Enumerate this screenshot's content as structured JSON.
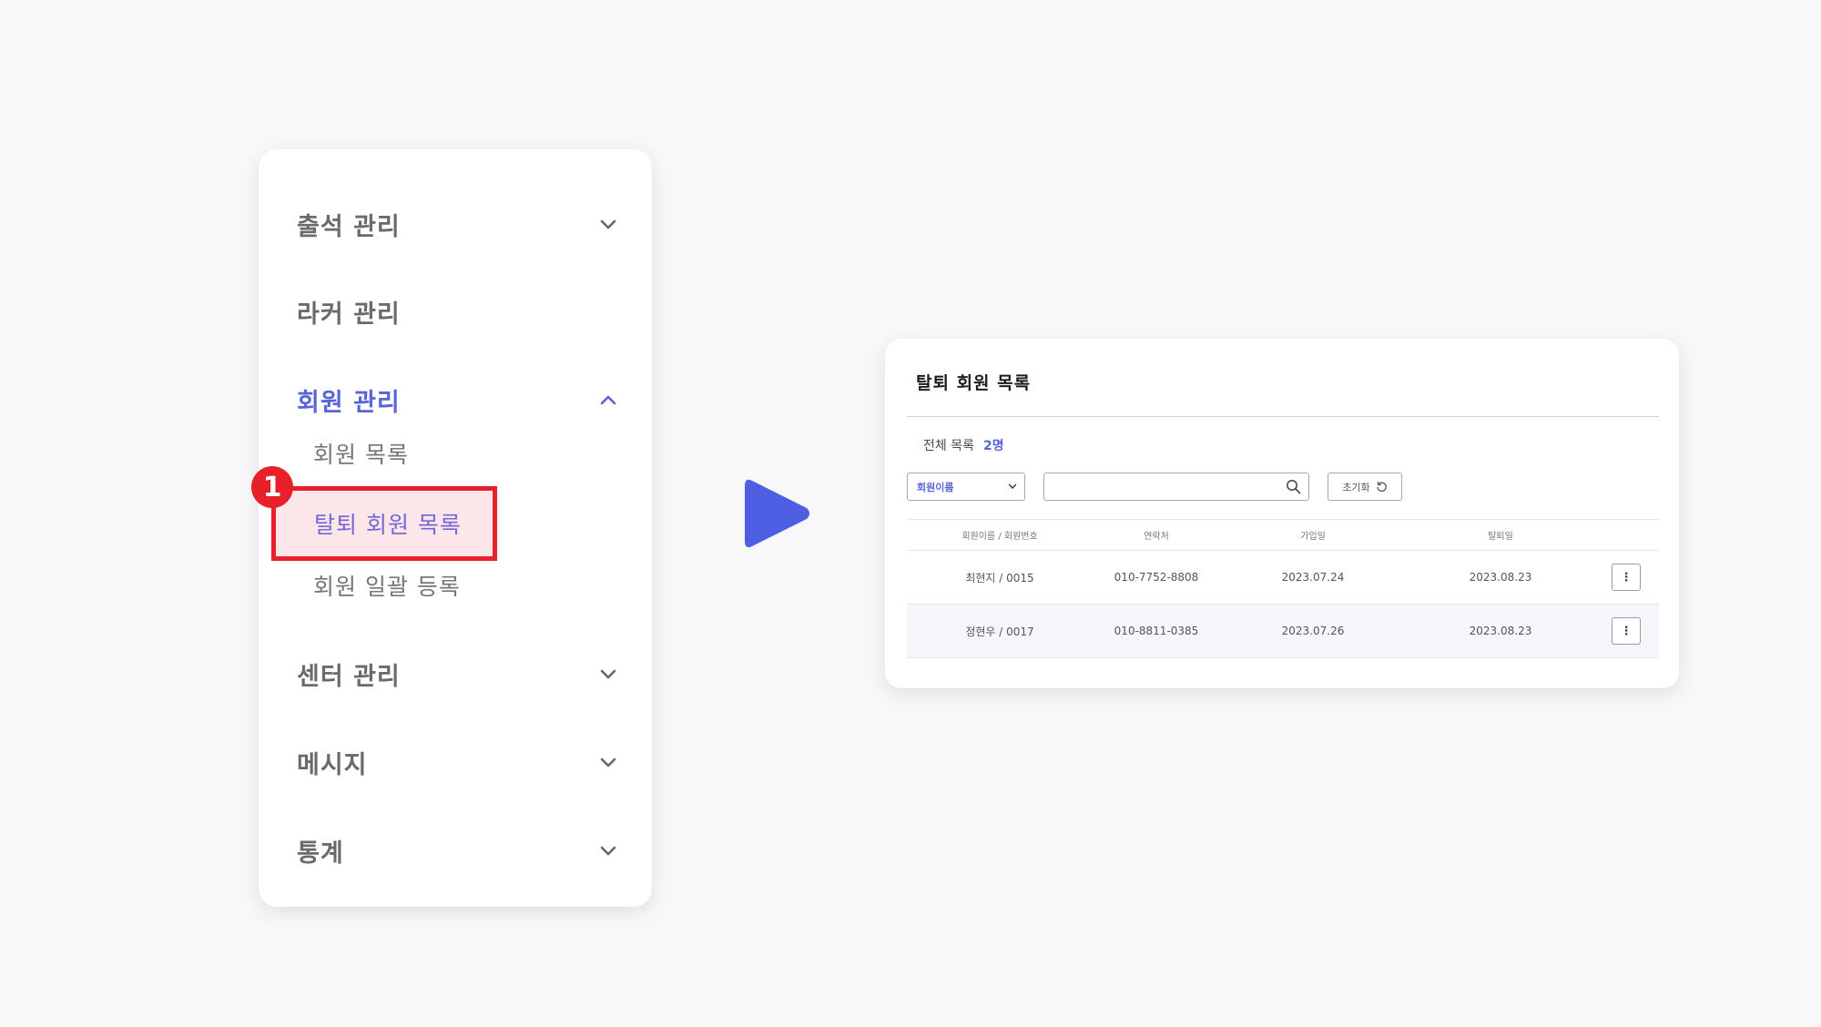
{
  "sidebar": {
    "items": [
      {
        "label": "출석 관리",
        "icon": "chevron-down-icon"
      },
      {
        "label": "라커 관리"
      },
      {
        "label": "회원 관리",
        "icon": "chevron-up-icon",
        "active": true,
        "children": [
          {
            "label": "회원 목록"
          },
          {
            "label": "탈퇴 회원 목록",
            "highlighted": true
          },
          {
            "label": "회원 일괄 등록"
          }
        ]
      },
      {
        "label": "센터 관리",
        "icon": "chevron-down-icon"
      },
      {
        "label": "메시지",
        "icon": "chevron-down-icon"
      },
      {
        "label": "통계",
        "icon": "chevron-down-icon"
      }
    ]
  },
  "step_badge": "1",
  "colors": {
    "accent": "#5865d8",
    "highlight_border": "#e8202a",
    "highlight_fill": "#fce6ea",
    "arrow": "#4f5fe3"
  },
  "panel": {
    "title": "탈퇴 회원 목록",
    "total_label": "전체 목록",
    "total_count": "2명",
    "filter_select": {
      "value": "회원이름",
      "icon": "chevron-down-icon"
    },
    "search": {
      "value": "",
      "icon": "search-icon"
    },
    "reset_button": {
      "label": "초기화",
      "icon": "refresh-icon"
    },
    "table": {
      "headers": [
        "회원이름 / 회원번호",
        "연락처",
        "가입일",
        "탈퇴일"
      ],
      "rows": [
        {
          "name": "최현지 / 0015",
          "phone": "010-7752-8808",
          "joined": "2023.07.24",
          "left": "2023.08.23",
          "action": "⋮"
        },
        {
          "name": "정현우 / 0017",
          "phone": "010-8811-0385",
          "joined": "2023.07.26",
          "left": "2023.08.23",
          "action": "⋮"
        }
      ]
    }
  }
}
